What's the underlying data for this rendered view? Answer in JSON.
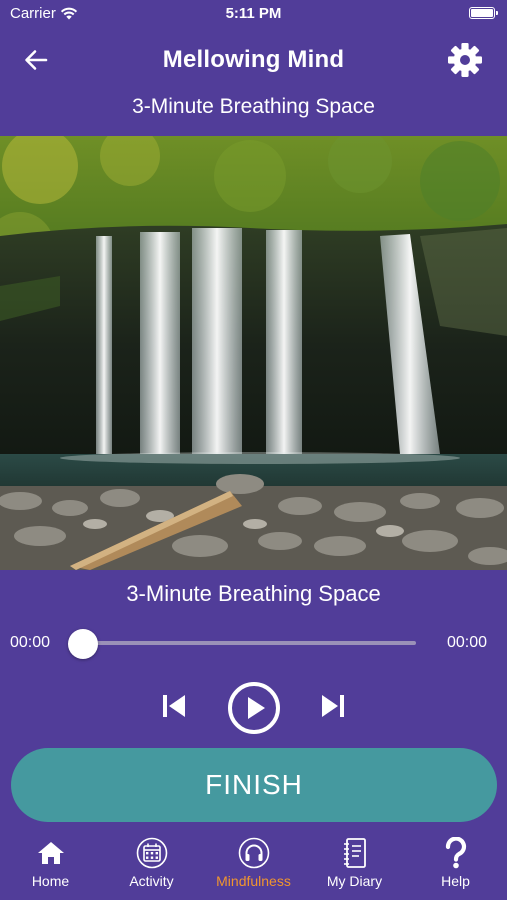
{
  "status_bar": {
    "carrier": "Carrier",
    "time": "5:11 PM"
  },
  "header": {
    "title": "Mellowing Mind",
    "back_icon": "arrow-left-icon",
    "settings_icon": "gear-icon"
  },
  "session": {
    "subtitle": "3-Minute Breathing Space",
    "track_title": "3-Minute Breathing Space"
  },
  "player": {
    "elapsed": "00:00",
    "duration": "00:00",
    "progress": 0
  },
  "actions": {
    "finish_label": "FINISH"
  },
  "tabs": [
    {
      "label": "Home",
      "icon": "home-icon",
      "active": false
    },
    {
      "label": "Activity",
      "icon": "calendar-icon",
      "active": false
    },
    {
      "label": "Mindfulness",
      "icon": "headphones-icon",
      "active": true
    },
    {
      "label": "My Diary",
      "icon": "diary-icon",
      "active": false
    },
    {
      "label": "Help",
      "icon": "question-icon",
      "active": false
    }
  ],
  "colors": {
    "background": "#513d99",
    "finish_button": "#45999f",
    "active_tab": "#f0952f",
    "text": "#ffffff"
  }
}
